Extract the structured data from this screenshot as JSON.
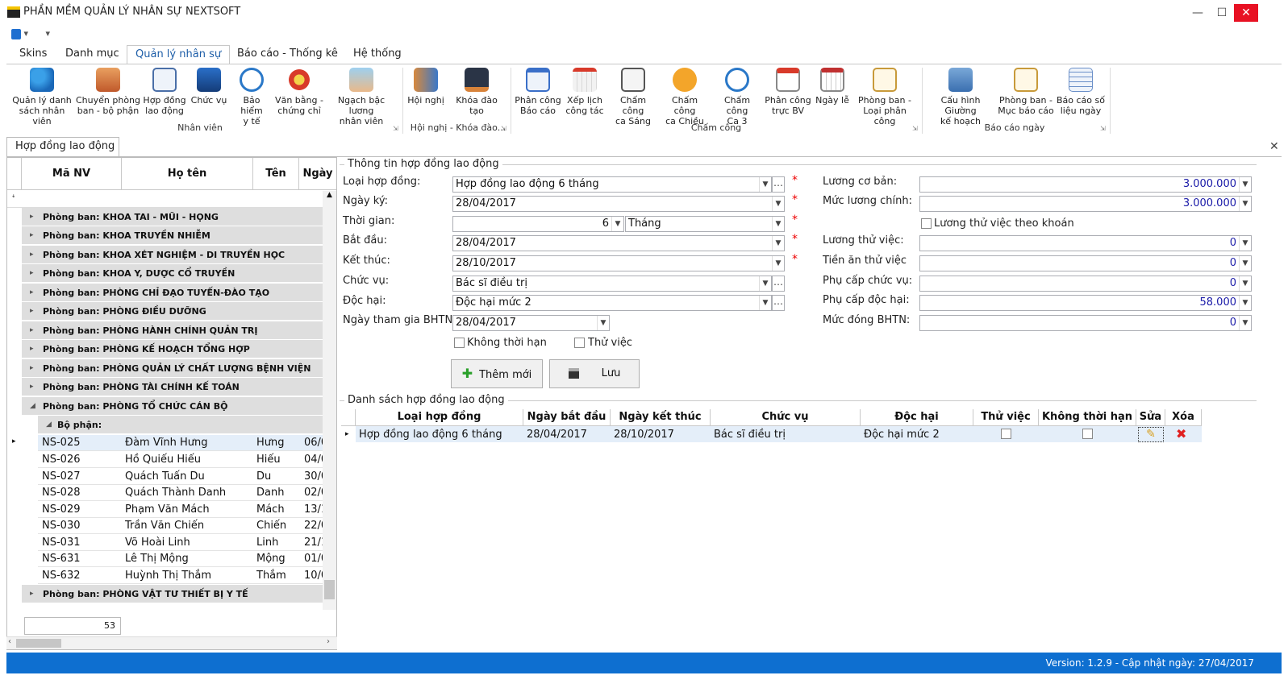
{
  "window": {
    "title": "PHẦN MỀM QUẢN LÝ NHÂN SỰ NEXTSOFT"
  },
  "ribbon_tabs": [
    "Skins",
    "Danh mục",
    "Quản lý nhân sự",
    "Báo cáo - Thống kê",
    "Hệ thống"
  ],
  "ribbon": {
    "buttons": [
      {
        "l1": "Quản lý danh",
        "l2": "sách nhân viên"
      },
      {
        "l1": "Chuyển phòng",
        "l2": "ban - bộ phận"
      },
      {
        "l1": "Hợp đồng",
        "l2": "lao động"
      },
      {
        "l1": "Chức vụ",
        "l2": ""
      },
      {
        "l1": "Bảo hiểm",
        "l2": "y tế"
      },
      {
        "l1": "Văn bằng -",
        "l2": "chứng chỉ"
      },
      {
        "l1": "Ngạch bậc lương",
        "l2": "nhân viên"
      },
      {
        "l1": "Hội nghị",
        "l2": ""
      },
      {
        "l1": "Khóa đào tạo",
        "l2": ""
      },
      {
        "l1": "Phân công",
        "l2": "Báo cáo"
      },
      {
        "l1": "Xếp lịch",
        "l2": "công tác"
      },
      {
        "l1": "Chấm công",
        "l2": "ca Sáng"
      },
      {
        "l1": "Chấm công",
        "l2": "ca Chiều"
      },
      {
        "l1": "Chấm công",
        "l2": "Ca 3"
      },
      {
        "l1": "Phân công",
        "l2": "trực BV"
      },
      {
        "l1": "Ngày lễ",
        "l2": ""
      },
      {
        "l1": "Phòng ban -",
        "l2": "Loại phân công"
      },
      {
        "l1": "Cấu hình Giường",
        "l2": "kế hoạch"
      },
      {
        "l1": "Phòng ban -",
        "l2": "Mục báo cáo"
      },
      {
        "l1": "Báo cáo số",
        "l2": "liệu ngày"
      }
    ],
    "groups": [
      "Nhân viên",
      "Hội nghị - Khóa đào...",
      "Chấm công",
      "Báo cáo ngày"
    ]
  },
  "doc_tab": "Hợp đồng lao động",
  "grid": {
    "headers": [
      "Mã NV",
      "Họ tên",
      "Tên",
      "Ngày"
    ],
    "departments_top": [
      "Phòng ban: KHOA TAI - MŨI - HỌNG",
      "Phòng ban: KHOA TRUYỀN NHIỄM",
      "Phòng ban: KHOA XÉT NGHIỆM - DI TRUYỀN HỌC",
      "Phòng ban: KHOA Y, DƯỢC CỔ TRUYỀN",
      "Phòng ban: PHÒNG CHỈ ĐẠO TUYẾN-ĐÀO TẠO",
      "Phòng ban: PHÒNG ĐIỀU DƯỠNG",
      "Phòng ban: PHÒNG HÀNH CHÍNH QUẢN TRỊ",
      "Phòng ban: PHÒNG KẾ HOẠCH TỔNG HỢP",
      "Phòng ban: PHÒNG QUẢN LÝ CHẤT LƯỢNG BỆNH VIỆN",
      "Phòng ban: PHÒNG TÀI CHÍNH KẾ TOÁN",
      "Phòng ban: PHÒNG TỔ CHỨC CÁN BỘ"
    ],
    "subgroup": "Bộ phận:",
    "rows": [
      {
        "id": "NS-025",
        "name": "Đàm Vĩnh Hưng",
        "first": "Hưng",
        "date": "06/0"
      },
      {
        "id": "NS-026",
        "name": "Hồ Quiếu Hiếu",
        "first": "Hiếu",
        "date": "04/0"
      },
      {
        "id": "NS-027",
        "name": "Quách Tuấn Du",
        "first": "Du",
        "date": "30/0"
      },
      {
        "id": "NS-028",
        "name": "Quách Thành Danh",
        "first": "Danh",
        "date": "02/0"
      },
      {
        "id": "NS-029",
        "name": "Phạm Văn Mách",
        "first": "Mách",
        "date": "13/1"
      },
      {
        "id": "NS-030",
        "name": "Trần Văn Chiến",
        "first": "Chiến",
        "date": "22/0"
      },
      {
        "id": "NS-031",
        "name": "Võ Hoài Linh",
        "first": "Linh",
        "date": "21/1"
      },
      {
        "id": "NS-631",
        "name": "Lê Thị Mộng",
        "first": "Mộng",
        "date": "01/0"
      },
      {
        "id": "NS-632",
        "name": "Huỳnh Thị Thắm",
        "first": "Thắm",
        "date": "10/0"
      }
    ],
    "department_last": "Phòng ban: PHÒNG VẬT TƯ THIẾT BỊ Y TẾ",
    "count": "53"
  },
  "form": {
    "section_title": "Thông tin hợp đồng lao động",
    "loai_label": "Loại hợp đồng:",
    "loai_value": "Hợp đồng lao động 6 tháng",
    "ngayky_label": "Ngày ký:",
    "ngayky_value": "28/04/2017",
    "thoigian_label": "Thời gian:",
    "thoigian_value": "6",
    "thoigian_unit": "Tháng",
    "batdau_label": "Bắt đầu:",
    "batdau_value": "28/04/2017",
    "ketthuc_label": "Kết thúc:",
    "ketthuc_value": "28/10/2017",
    "chucvu_label": "Chức vụ:",
    "chucvu_value": "Bác sĩ điều trị",
    "dochai_label": "Độc hại:",
    "dochai_value": "Độc hại mức 2",
    "bhtn_label": "Ngày tham gia BHTN:",
    "bhtn_value": "28/04/2017",
    "khong_thoi_han": "Không thời hạn",
    "thu_viec": "Thử việc",
    "btn_add": "Thêm mới",
    "btn_save": "Lưu",
    "luong_cb_label": "Lương cơ bản:",
    "luong_cb_value": "3.000.000",
    "muc_luong_label": "Mức lương chính:",
    "muc_luong_value": "3.000.000",
    "luong_khoan_label": "Lương thử việc theo khoán",
    "luong_tv_label": "Lương thử việc:",
    "luong_tv_value": "0",
    "tien_an_label": "Tiền ăn thử việc",
    "tien_an_value": "0",
    "pc_chucvu_label": "Phụ cấp chức vụ:",
    "pc_chucvu_value": "0",
    "pc_dochai_label": "Phụ cấp độc hại:",
    "pc_dochai_value": "58.000",
    "bhtn_muc_label": "Mức đóng BHTN:",
    "bhtn_muc_value": "0"
  },
  "contracts": {
    "section_title": "Danh sách hợp đồng lao động",
    "headers": [
      "Loại hợp đồng",
      "Ngày bắt đầu",
      "Ngày kết thúc",
      "Chức vụ",
      "Độc hại",
      "Thử việc",
      "Không thời hạn",
      "Sửa",
      "Xóa"
    ],
    "row": {
      "loai": "Hợp đồng lao động 6 tháng",
      "bd": "28/04/2017",
      "kt": "28/10/2017",
      "cv": "Bác sĩ điều trị",
      "dh": "Độc hại mức 2"
    }
  },
  "status": {
    "text": "Version: 1.2.9 - Cập nhật ngày: 27/04/2017"
  }
}
